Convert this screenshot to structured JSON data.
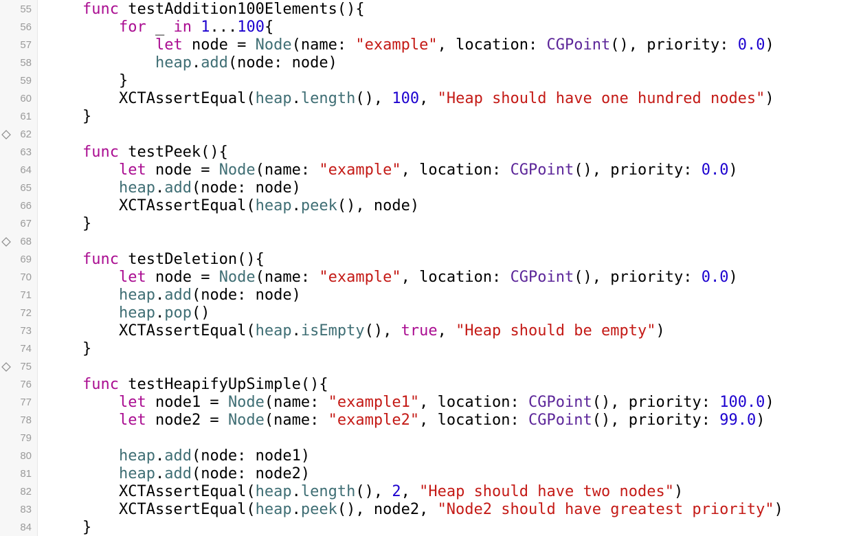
{
  "editor": {
    "colors": {
      "keyword": "#aa0d91",
      "string": "#c41a16",
      "number": "#1c00cf",
      "project_identifier": "#3f6e74",
      "system_type": "#5c2699",
      "plain": "#000000",
      "line_number": "#9a9a9a"
    },
    "lines": [
      {
        "number": "55",
        "test_marker": false,
        "tokens": [
          {
            "text": "    ",
            "kind": "pl"
          },
          {
            "text": "func",
            "kind": "kw"
          },
          {
            "text": " testAddition100Elements(){",
            "kind": "pl"
          }
        ]
      },
      {
        "number": "56",
        "test_marker": false,
        "tokens": [
          {
            "text": "        ",
            "kind": "pl"
          },
          {
            "text": "for",
            "kind": "kw"
          },
          {
            "text": " _ ",
            "kind": "pl"
          },
          {
            "text": "in",
            "kind": "kw"
          },
          {
            "text": " ",
            "kind": "pl"
          },
          {
            "text": "1",
            "kind": "num"
          },
          {
            "text": "...",
            "kind": "pl"
          },
          {
            "text": "100",
            "kind": "num"
          },
          {
            "text": "{",
            "kind": "pl"
          }
        ]
      },
      {
        "number": "57",
        "test_marker": false,
        "tokens": [
          {
            "text": "            ",
            "kind": "pl"
          },
          {
            "text": "let",
            "kind": "kw"
          },
          {
            "text": " node = ",
            "kind": "pl"
          },
          {
            "text": "Node",
            "kind": "type"
          },
          {
            "text": "(name: ",
            "kind": "pl"
          },
          {
            "text": "\"example\"",
            "kind": "str"
          },
          {
            "text": ", location: ",
            "kind": "pl"
          },
          {
            "text": "CGPoint",
            "kind": "ty2"
          },
          {
            "text": "(), priority: ",
            "kind": "pl"
          },
          {
            "text": "0.0",
            "kind": "num"
          },
          {
            "text": ")",
            "kind": "pl"
          }
        ]
      },
      {
        "number": "58",
        "test_marker": false,
        "tokens": [
          {
            "text": "            ",
            "kind": "pl"
          },
          {
            "text": "heap",
            "kind": "type"
          },
          {
            "text": ".",
            "kind": "pl"
          },
          {
            "text": "add",
            "kind": "type"
          },
          {
            "text": "(node: node)",
            "kind": "pl"
          }
        ]
      },
      {
        "number": "59",
        "test_marker": false,
        "tokens": [
          {
            "text": "        }",
            "kind": "pl"
          }
        ]
      },
      {
        "number": "60",
        "test_marker": false,
        "tokens": [
          {
            "text": "        XCTAssertEqual(",
            "kind": "pl"
          },
          {
            "text": "heap",
            "kind": "type"
          },
          {
            "text": ".",
            "kind": "pl"
          },
          {
            "text": "length",
            "kind": "type"
          },
          {
            "text": "(), ",
            "kind": "pl"
          },
          {
            "text": "100",
            "kind": "num"
          },
          {
            "text": ", ",
            "kind": "pl"
          },
          {
            "text": "\"Heap should have one hundred nodes\"",
            "kind": "str"
          },
          {
            "text": ")",
            "kind": "pl"
          }
        ]
      },
      {
        "number": "61",
        "test_marker": false,
        "tokens": [
          {
            "text": "    }",
            "kind": "pl"
          }
        ]
      },
      {
        "number": "62",
        "test_marker": true,
        "tokens": []
      },
      {
        "number": "63",
        "test_marker": false,
        "tokens": [
          {
            "text": "    ",
            "kind": "pl"
          },
          {
            "text": "func",
            "kind": "kw"
          },
          {
            "text": " testPeek(){",
            "kind": "pl"
          }
        ]
      },
      {
        "number": "64",
        "test_marker": false,
        "tokens": [
          {
            "text": "        ",
            "kind": "pl"
          },
          {
            "text": "let",
            "kind": "kw"
          },
          {
            "text": " node = ",
            "kind": "pl"
          },
          {
            "text": "Node",
            "kind": "type"
          },
          {
            "text": "(name: ",
            "kind": "pl"
          },
          {
            "text": "\"example\"",
            "kind": "str"
          },
          {
            "text": ", location: ",
            "kind": "pl"
          },
          {
            "text": "CGPoint",
            "kind": "ty2"
          },
          {
            "text": "(), priority: ",
            "kind": "pl"
          },
          {
            "text": "0.0",
            "kind": "num"
          },
          {
            "text": ")",
            "kind": "pl"
          }
        ]
      },
      {
        "number": "65",
        "test_marker": false,
        "tokens": [
          {
            "text": "        ",
            "kind": "pl"
          },
          {
            "text": "heap",
            "kind": "type"
          },
          {
            "text": ".",
            "kind": "pl"
          },
          {
            "text": "add",
            "kind": "type"
          },
          {
            "text": "(node: node)",
            "kind": "pl"
          }
        ]
      },
      {
        "number": "66",
        "test_marker": false,
        "tokens": [
          {
            "text": "        XCTAssertEqual(",
            "kind": "pl"
          },
          {
            "text": "heap",
            "kind": "type"
          },
          {
            "text": ".",
            "kind": "pl"
          },
          {
            "text": "peek",
            "kind": "type"
          },
          {
            "text": "(), node)",
            "kind": "pl"
          }
        ]
      },
      {
        "number": "67",
        "test_marker": false,
        "tokens": [
          {
            "text": "    }",
            "kind": "pl"
          }
        ]
      },
      {
        "number": "68",
        "test_marker": true,
        "tokens": []
      },
      {
        "number": "69",
        "test_marker": false,
        "tokens": [
          {
            "text": "    ",
            "kind": "pl"
          },
          {
            "text": "func",
            "kind": "kw"
          },
          {
            "text": " testDeletion(){",
            "kind": "pl"
          }
        ]
      },
      {
        "number": "70",
        "test_marker": false,
        "tokens": [
          {
            "text": "        ",
            "kind": "pl"
          },
          {
            "text": "let",
            "kind": "kw"
          },
          {
            "text": " node = ",
            "kind": "pl"
          },
          {
            "text": "Node",
            "kind": "type"
          },
          {
            "text": "(name: ",
            "kind": "pl"
          },
          {
            "text": "\"example\"",
            "kind": "str"
          },
          {
            "text": ", location: ",
            "kind": "pl"
          },
          {
            "text": "CGPoint",
            "kind": "ty2"
          },
          {
            "text": "(), priority: ",
            "kind": "pl"
          },
          {
            "text": "0.0",
            "kind": "num"
          },
          {
            "text": ")",
            "kind": "pl"
          }
        ]
      },
      {
        "number": "71",
        "test_marker": false,
        "tokens": [
          {
            "text": "        ",
            "kind": "pl"
          },
          {
            "text": "heap",
            "kind": "type"
          },
          {
            "text": ".",
            "kind": "pl"
          },
          {
            "text": "add",
            "kind": "type"
          },
          {
            "text": "(node: node)",
            "kind": "pl"
          }
        ]
      },
      {
        "number": "72",
        "test_marker": false,
        "tokens": [
          {
            "text": "        ",
            "kind": "pl"
          },
          {
            "text": "heap",
            "kind": "type"
          },
          {
            "text": ".",
            "kind": "pl"
          },
          {
            "text": "pop",
            "kind": "type"
          },
          {
            "text": "()",
            "kind": "pl"
          }
        ]
      },
      {
        "number": "73",
        "test_marker": false,
        "tokens": [
          {
            "text": "        XCTAssertEqual(",
            "kind": "pl"
          },
          {
            "text": "heap",
            "kind": "type"
          },
          {
            "text": ".",
            "kind": "pl"
          },
          {
            "text": "isEmpty",
            "kind": "type"
          },
          {
            "text": "(), ",
            "kind": "pl"
          },
          {
            "text": "true",
            "kind": "kw"
          },
          {
            "text": ", ",
            "kind": "pl"
          },
          {
            "text": "\"Heap should be empty\"",
            "kind": "str"
          },
          {
            "text": ")",
            "kind": "pl"
          }
        ]
      },
      {
        "number": "74",
        "test_marker": false,
        "tokens": [
          {
            "text": "    }",
            "kind": "pl"
          }
        ]
      },
      {
        "number": "75",
        "test_marker": true,
        "tokens": []
      },
      {
        "number": "76",
        "test_marker": false,
        "tokens": [
          {
            "text": "    ",
            "kind": "pl"
          },
          {
            "text": "func",
            "kind": "kw"
          },
          {
            "text": " testHeapifyUpSimple(){",
            "kind": "pl"
          }
        ]
      },
      {
        "number": "77",
        "test_marker": false,
        "tokens": [
          {
            "text": "        ",
            "kind": "pl"
          },
          {
            "text": "let",
            "kind": "kw"
          },
          {
            "text": " node1 = ",
            "kind": "pl"
          },
          {
            "text": "Node",
            "kind": "type"
          },
          {
            "text": "(name: ",
            "kind": "pl"
          },
          {
            "text": "\"example1\"",
            "kind": "str"
          },
          {
            "text": ", location: ",
            "kind": "pl"
          },
          {
            "text": "CGPoint",
            "kind": "ty2"
          },
          {
            "text": "(), priority: ",
            "kind": "pl"
          },
          {
            "text": "100.0",
            "kind": "num"
          },
          {
            "text": ")",
            "kind": "pl"
          }
        ]
      },
      {
        "number": "78",
        "test_marker": false,
        "tokens": [
          {
            "text": "        ",
            "kind": "pl"
          },
          {
            "text": "let",
            "kind": "kw"
          },
          {
            "text": " node2 = ",
            "kind": "pl"
          },
          {
            "text": "Node",
            "kind": "type"
          },
          {
            "text": "(name: ",
            "kind": "pl"
          },
          {
            "text": "\"example2\"",
            "kind": "str"
          },
          {
            "text": ", location: ",
            "kind": "pl"
          },
          {
            "text": "CGPoint",
            "kind": "ty2"
          },
          {
            "text": "(), priority: ",
            "kind": "pl"
          },
          {
            "text": "99.0",
            "kind": "num"
          },
          {
            "text": ")",
            "kind": "pl"
          }
        ]
      },
      {
        "number": "79",
        "test_marker": false,
        "tokens": []
      },
      {
        "number": "80",
        "test_marker": false,
        "tokens": [
          {
            "text": "        ",
            "kind": "pl"
          },
          {
            "text": "heap",
            "kind": "type"
          },
          {
            "text": ".",
            "kind": "pl"
          },
          {
            "text": "add",
            "kind": "type"
          },
          {
            "text": "(node: node1)",
            "kind": "pl"
          }
        ]
      },
      {
        "number": "81",
        "test_marker": false,
        "tokens": [
          {
            "text": "        ",
            "kind": "pl"
          },
          {
            "text": "heap",
            "kind": "type"
          },
          {
            "text": ".",
            "kind": "pl"
          },
          {
            "text": "add",
            "kind": "type"
          },
          {
            "text": "(node: node2)",
            "kind": "pl"
          }
        ]
      },
      {
        "number": "82",
        "test_marker": false,
        "tokens": [
          {
            "text": "        XCTAssertEqual(",
            "kind": "pl"
          },
          {
            "text": "heap",
            "kind": "type"
          },
          {
            "text": ".",
            "kind": "pl"
          },
          {
            "text": "length",
            "kind": "type"
          },
          {
            "text": "(), ",
            "kind": "pl"
          },
          {
            "text": "2",
            "kind": "num"
          },
          {
            "text": ", ",
            "kind": "pl"
          },
          {
            "text": "\"Heap should have two nodes\"",
            "kind": "str"
          },
          {
            "text": ")",
            "kind": "pl"
          }
        ]
      },
      {
        "number": "83",
        "test_marker": false,
        "tokens": [
          {
            "text": "        XCTAssertEqual(",
            "kind": "pl"
          },
          {
            "text": "heap",
            "kind": "type"
          },
          {
            "text": ".",
            "kind": "pl"
          },
          {
            "text": "peek",
            "kind": "type"
          },
          {
            "text": "(), node2, ",
            "kind": "pl"
          },
          {
            "text": "\"Node2 should have greatest priority\"",
            "kind": "str"
          },
          {
            "text": ")",
            "kind": "pl"
          }
        ]
      },
      {
        "number": "84",
        "test_marker": false,
        "tokens": [
          {
            "text": "    }",
            "kind": "pl"
          }
        ]
      }
    ]
  }
}
